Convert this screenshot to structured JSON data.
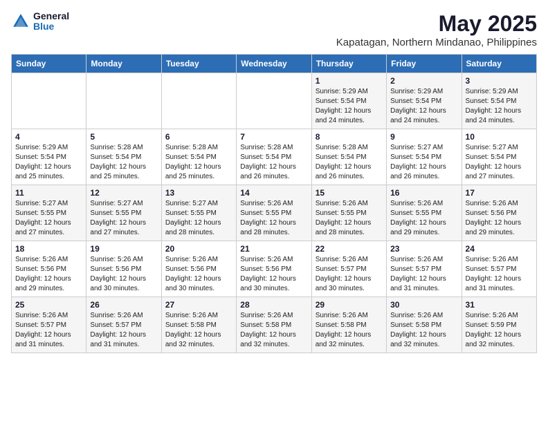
{
  "header": {
    "logo_general": "General",
    "logo_blue": "Blue",
    "month_title": "May 2025",
    "location": "Kapatagan, Northern Mindanao, Philippines"
  },
  "days_of_week": [
    "Sunday",
    "Monday",
    "Tuesday",
    "Wednesday",
    "Thursday",
    "Friday",
    "Saturday"
  ],
  "weeks": [
    [
      {
        "day": "",
        "info": ""
      },
      {
        "day": "",
        "info": ""
      },
      {
        "day": "",
        "info": ""
      },
      {
        "day": "",
        "info": ""
      },
      {
        "day": "1",
        "info": "Sunrise: 5:29 AM\nSunset: 5:54 PM\nDaylight: 12 hours\nand 24 minutes."
      },
      {
        "day": "2",
        "info": "Sunrise: 5:29 AM\nSunset: 5:54 PM\nDaylight: 12 hours\nand 24 minutes."
      },
      {
        "day": "3",
        "info": "Sunrise: 5:29 AM\nSunset: 5:54 PM\nDaylight: 12 hours\nand 24 minutes."
      }
    ],
    [
      {
        "day": "4",
        "info": "Sunrise: 5:29 AM\nSunset: 5:54 PM\nDaylight: 12 hours\nand 25 minutes."
      },
      {
        "day": "5",
        "info": "Sunrise: 5:28 AM\nSunset: 5:54 PM\nDaylight: 12 hours\nand 25 minutes."
      },
      {
        "day": "6",
        "info": "Sunrise: 5:28 AM\nSunset: 5:54 PM\nDaylight: 12 hours\nand 25 minutes."
      },
      {
        "day": "7",
        "info": "Sunrise: 5:28 AM\nSunset: 5:54 PM\nDaylight: 12 hours\nand 26 minutes."
      },
      {
        "day": "8",
        "info": "Sunrise: 5:28 AM\nSunset: 5:54 PM\nDaylight: 12 hours\nand 26 minutes."
      },
      {
        "day": "9",
        "info": "Sunrise: 5:27 AM\nSunset: 5:54 PM\nDaylight: 12 hours\nand 26 minutes."
      },
      {
        "day": "10",
        "info": "Sunrise: 5:27 AM\nSunset: 5:54 PM\nDaylight: 12 hours\nand 27 minutes."
      }
    ],
    [
      {
        "day": "11",
        "info": "Sunrise: 5:27 AM\nSunset: 5:55 PM\nDaylight: 12 hours\nand 27 minutes."
      },
      {
        "day": "12",
        "info": "Sunrise: 5:27 AM\nSunset: 5:55 PM\nDaylight: 12 hours\nand 27 minutes."
      },
      {
        "day": "13",
        "info": "Sunrise: 5:27 AM\nSunset: 5:55 PM\nDaylight: 12 hours\nand 28 minutes."
      },
      {
        "day": "14",
        "info": "Sunrise: 5:26 AM\nSunset: 5:55 PM\nDaylight: 12 hours\nand 28 minutes."
      },
      {
        "day": "15",
        "info": "Sunrise: 5:26 AM\nSunset: 5:55 PM\nDaylight: 12 hours\nand 28 minutes."
      },
      {
        "day": "16",
        "info": "Sunrise: 5:26 AM\nSunset: 5:55 PM\nDaylight: 12 hours\nand 29 minutes."
      },
      {
        "day": "17",
        "info": "Sunrise: 5:26 AM\nSunset: 5:56 PM\nDaylight: 12 hours\nand 29 minutes."
      }
    ],
    [
      {
        "day": "18",
        "info": "Sunrise: 5:26 AM\nSunset: 5:56 PM\nDaylight: 12 hours\nand 29 minutes."
      },
      {
        "day": "19",
        "info": "Sunrise: 5:26 AM\nSunset: 5:56 PM\nDaylight: 12 hours\nand 30 minutes."
      },
      {
        "day": "20",
        "info": "Sunrise: 5:26 AM\nSunset: 5:56 PM\nDaylight: 12 hours\nand 30 minutes."
      },
      {
        "day": "21",
        "info": "Sunrise: 5:26 AM\nSunset: 5:56 PM\nDaylight: 12 hours\nand 30 minutes."
      },
      {
        "day": "22",
        "info": "Sunrise: 5:26 AM\nSunset: 5:57 PM\nDaylight: 12 hours\nand 30 minutes."
      },
      {
        "day": "23",
        "info": "Sunrise: 5:26 AM\nSunset: 5:57 PM\nDaylight: 12 hours\nand 31 minutes."
      },
      {
        "day": "24",
        "info": "Sunrise: 5:26 AM\nSunset: 5:57 PM\nDaylight: 12 hours\nand 31 minutes."
      }
    ],
    [
      {
        "day": "25",
        "info": "Sunrise: 5:26 AM\nSunset: 5:57 PM\nDaylight: 12 hours\nand 31 minutes."
      },
      {
        "day": "26",
        "info": "Sunrise: 5:26 AM\nSunset: 5:57 PM\nDaylight: 12 hours\nand 31 minutes."
      },
      {
        "day": "27",
        "info": "Sunrise: 5:26 AM\nSunset: 5:58 PM\nDaylight: 12 hours\nand 32 minutes."
      },
      {
        "day": "28",
        "info": "Sunrise: 5:26 AM\nSunset: 5:58 PM\nDaylight: 12 hours\nand 32 minutes."
      },
      {
        "day": "29",
        "info": "Sunrise: 5:26 AM\nSunset: 5:58 PM\nDaylight: 12 hours\nand 32 minutes."
      },
      {
        "day": "30",
        "info": "Sunrise: 5:26 AM\nSunset: 5:58 PM\nDaylight: 12 hours\nand 32 minutes."
      },
      {
        "day": "31",
        "info": "Sunrise: 5:26 AM\nSunset: 5:59 PM\nDaylight: 12 hours\nand 32 minutes."
      }
    ]
  ]
}
